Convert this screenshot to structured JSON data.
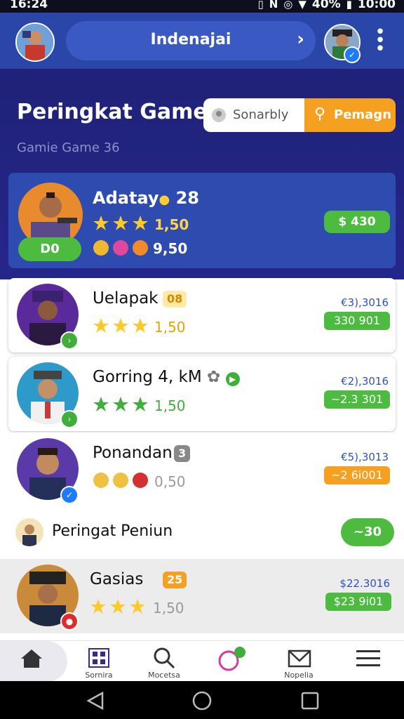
{
  "status_bar": {
    "time": "16:24",
    "battery": "40%",
    "clock": "10:00"
  },
  "app_bar": {
    "title": "Indenajai"
  },
  "hero": {
    "heading": "Peringkat Game",
    "subheading": "Gamie Game 36",
    "search": {
      "placeholder": "Sonarbly",
      "button_label": "Pemagn"
    }
  },
  "leaderboard": {
    "top": {
      "name": "Adatay",
      "level": "28",
      "rating": "1,50",
      "score": "9,50",
      "tag": "D0",
      "value": "$ 430"
    },
    "entries": [
      {
        "name": "Uelapak",
        "badge": "08",
        "rating": "1,50",
        "small": "€3),3016",
        "value": "330 901"
      },
      {
        "name": "Gorring 4, kM",
        "rating": "1,50",
        "small": "€2),3016",
        "value": "~2.3 301"
      },
      {
        "name": "Ponandan",
        "badge": "3",
        "rating": "0,50",
        "small": "€5),3013",
        "value": "~2 6i001"
      },
      {
        "name": "Gasias",
        "badge": "25",
        "rating": "1,50",
        "small": "$22.3016",
        "value": "$23 9i01"
      }
    ],
    "highlight": {
      "name": "Peringat Peniun",
      "value": "~30"
    }
  },
  "bottom_nav": [
    {
      "label": ""
    },
    {
      "label": "Sornira"
    },
    {
      "label": "Mocetsa"
    },
    {
      "label": ""
    },
    {
      "label": "Nopelia"
    },
    {
      "label": ""
    }
  ],
  "colors": {
    "app_bar": "#2a46a8",
    "hero_bg": "#1f2278",
    "accent_orange": "#f5a020",
    "green": "#4cbb3f"
  }
}
